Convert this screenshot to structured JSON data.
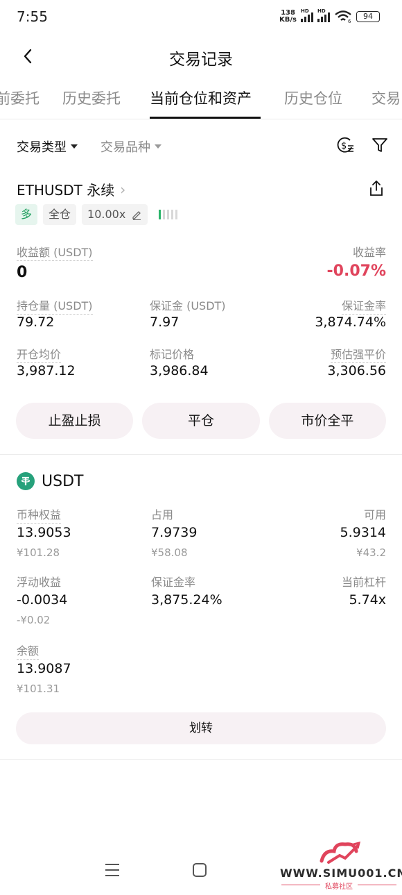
{
  "status_bar": {
    "time": "7:55",
    "net_speed_value": "138",
    "net_speed_unit": "KB/s",
    "signal_label": "HD",
    "wifi_label": "6",
    "battery": "94"
  },
  "header": {
    "title": "交易记录"
  },
  "tabs": [
    {
      "label": "前委托"
    },
    {
      "label": "历史委托"
    },
    {
      "label": "当前仓位和资产",
      "active": true
    },
    {
      "label": "历史仓位"
    },
    {
      "label": "交易"
    }
  ],
  "filters": {
    "trade_type": "交易类型",
    "trade_symbol": "交易品种"
  },
  "position": {
    "title": "ETHUSDT 永续",
    "tags": {
      "side": "多",
      "margin_mode": "全仓",
      "leverage": "10.00x"
    },
    "pnl_label": "收益额 (USDT)",
    "pnl_value": "0",
    "roi_label": "收益率",
    "roi_value": "-0.07%",
    "size_label": "持仓量 (USDT)",
    "size_value": "79.72",
    "margin_label": "保证金 (USDT)",
    "margin_value": "7.97",
    "margin_ratio_label": "保证金率",
    "margin_ratio_value": "3,874.74%",
    "entry_price_label": "开仓均价",
    "entry_price_value": "3,987.12",
    "mark_price_label": "标记价格",
    "mark_price_value": "3,986.84",
    "liq_price_label": "预估强平价",
    "liq_price_value": "3,306.56",
    "actions": {
      "tpsl": "止盈止损",
      "close": "平仓",
      "market_close_all": "市价全平"
    }
  },
  "asset": {
    "name": "USDT",
    "equity_label": "币种权益",
    "equity_value": "13.9053",
    "equity_cny": "¥101.28",
    "used_label": "占用",
    "used_value": "7.9739",
    "used_cny": "¥58.08",
    "available_label": "可用",
    "available_value": "5.9314",
    "available_cny": "¥43.2",
    "upnl_label": "浮动收益",
    "upnl_value": "-0.0034",
    "upnl_cny": "-¥0.02",
    "margin_ratio_label": "保证金率",
    "margin_ratio_value": "3,875.24%",
    "leverage_label": "当前杠杆",
    "leverage_value": "5.74x",
    "balance_label": "余额",
    "balance_value": "13.9087",
    "balance_cny": "¥101.31",
    "transfer_label": "划转"
  },
  "watermark": {
    "text": "WWW.SIMU001.CN",
    "sub": "私募社区"
  },
  "colors": {
    "negative": "#e0445c",
    "long_green": "#22a060",
    "button_bg": "#f7f1f4",
    "tether": "#26a17b"
  }
}
